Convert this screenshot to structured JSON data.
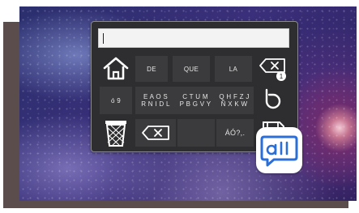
{
  "keyboard": {
    "text_value": "",
    "keys": {
      "de": "DE",
      "que": "QUE",
      "la": "LA",
      "row2_a": "ó 9",
      "row2_b_line1": "E A O S",
      "row2_b_line2": "R N I D L",
      "row2_c_line1": "C T U M",
      "row2_c_line2": "P B G V Y",
      "row2_d_line1": "Q H F Z J",
      "row2_d_line2": "Ñ X K W",
      "row3_punct": "ÁÓ?,."
    },
    "badge_count": "1"
  },
  "icons": [
    "home-icon",
    "backspace-history-icon",
    "bubble-logo-icon",
    "trash-icon",
    "backspace-icon",
    "save-icon"
  ],
  "colors": {
    "keyboard_bg": "#2e2e30",
    "key_bg": "#3b3b3d",
    "key_text": "#e6e6e6",
    "logo_blue": "#2b6fd6"
  }
}
